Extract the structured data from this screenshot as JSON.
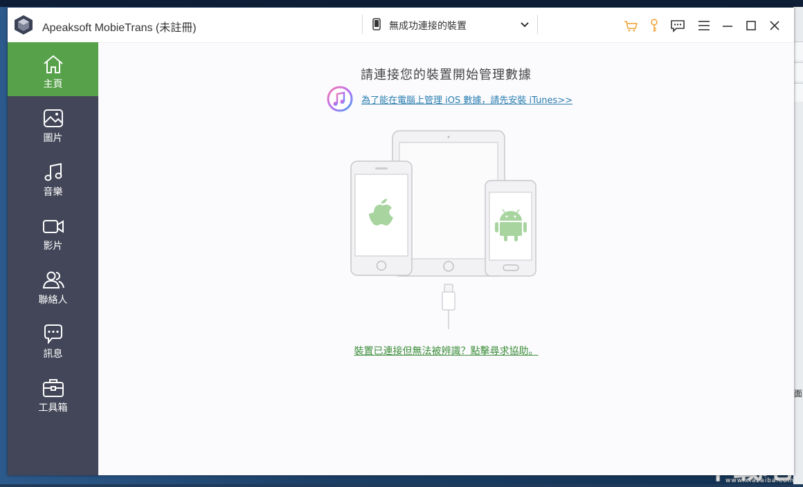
{
  "app": {
    "title": "Apeaksoft MobieTrans (未註冊)"
  },
  "device_selector": {
    "value": "無成功連接的裝置"
  },
  "toolbar": {
    "icons": [
      "cart-icon",
      "key-icon",
      "feedback-icon",
      "menu-icon",
      "minimize-icon",
      "maximize-icon",
      "close-icon"
    ]
  },
  "sidebar": {
    "items": [
      {
        "label": "主頁",
        "icon": "home-icon",
        "active": true
      },
      {
        "label": "圖片",
        "icon": "image-icon",
        "active": false
      },
      {
        "label": "音樂",
        "icon": "music-icon",
        "active": false
      },
      {
        "label": "影片",
        "icon": "video-icon",
        "active": false
      },
      {
        "label": "聯絡人",
        "icon": "contacts-icon",
        "active": false
      },
      {
        "label": "訊息",
        "icon": "message-icon",
        "active": false
      },
      {
        "label": "工具箱",
        "icon": "toolbox-icon",
        "active": false
      }
    ]
  },
  "main": {
    "headline": "請連接您的裝置開始管理數據",
    "itunes_link": "為了能在電腦上管理 iOS 數據，請先安裝 iTunes>>",
    "help_link": "裝置已連接但無法被辨識？點擊尋求協助。"
  },
  "colors": {
    "sidebar_bg": "#434658",
    "active_nav": "#57a14b",
    "link_blue": "#2a7fb0",
    "link_green": "#3d8f3a",
    "accent_orange": "#f0a030"
  },
  "desktop": {
    "right_edge_label": "面",
    "watermark": "下载吧",
    "watermark_url": "www.xiazaiba.com"
  }
}
